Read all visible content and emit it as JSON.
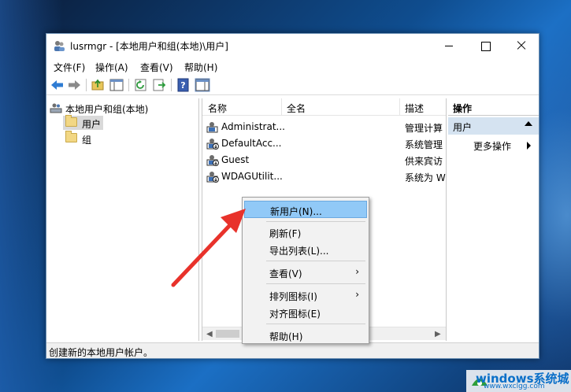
{
  "window": {
    "title": "lusrmgr - [本地用户和组(本地)\\用户]"
  },
  "menubar": [
    {
      "label": "文件(F)"
    },
    {
      "label": "操作(A)"
    },
    {
      "label": "查看(V)"
    },
    {
      "label": "帮助(H)"
    }
  ],
  "tree": {
    "root": "本地用户和组(本地)",
    "items": [
      {
        "label": "用户",
        "selected": true
      },
      {
        "label": "组",
        "selected": false
      }
    ]
  },
  "list": {
    "columns": [
      "名称",
      "全名",
      "描述"
    ],
    "rows": [
      {
        "name": "Administrat...",
        "fullname": "",
        "desc": "管理计算"
      },
      {
        "name": "DefaultAcc...",
        "fullname": "",
        "desc": "系统管理"
      },
      {
        "name": "Guest",
        "fullname": "",
        "desc": "供来宾访"
      },
      {
        "name": "WDAGUtilit...",
        "fullname": "",
        "desc": "系统为 W"
      }
    ]
  },
  "actions": {
    "title": "操作",
    "section": "用户",
    "more": "更多操作"
  },
  "status": {
    "text": "创建新的本地用户帐户。"
  },
  "context_menu": {
    "items": [
      {
        "label": "新用户(N)...",
        "highlighted": true,
        "submenu": false
      },
      {
        "label": "刷新(F)",
        "highlighted": false,
        "submenu": false
      },
      {
        "label": "导出列表(L)...",
        "highlighted": false,
        "submenu": false
      },
      {
        "label": "查看(V)",
        "highlighted": false,
        "submenu": true
      },
      {
        "label": "排列图标(I)",
        "highlighted": false,
        "submenu": true
      },
      {
        "label": "对齐图标(E)",
        "highlighted": false,
        "submenu": false
      },
      {
        "label": "帮助(H)",
        "highlighted": false,
        "submenu": false
      }
    ],
    "submenu_glyph": "›"
  },
  "watermark": {
    "brand": "windows系统城",
    "url": "www.wxclgg.com"
  },
  "colors": {
    "arrow": "#e8322b",
    "highlight": "#91c9f7",
    "action_section": "#d5e3f1"
  }
}
